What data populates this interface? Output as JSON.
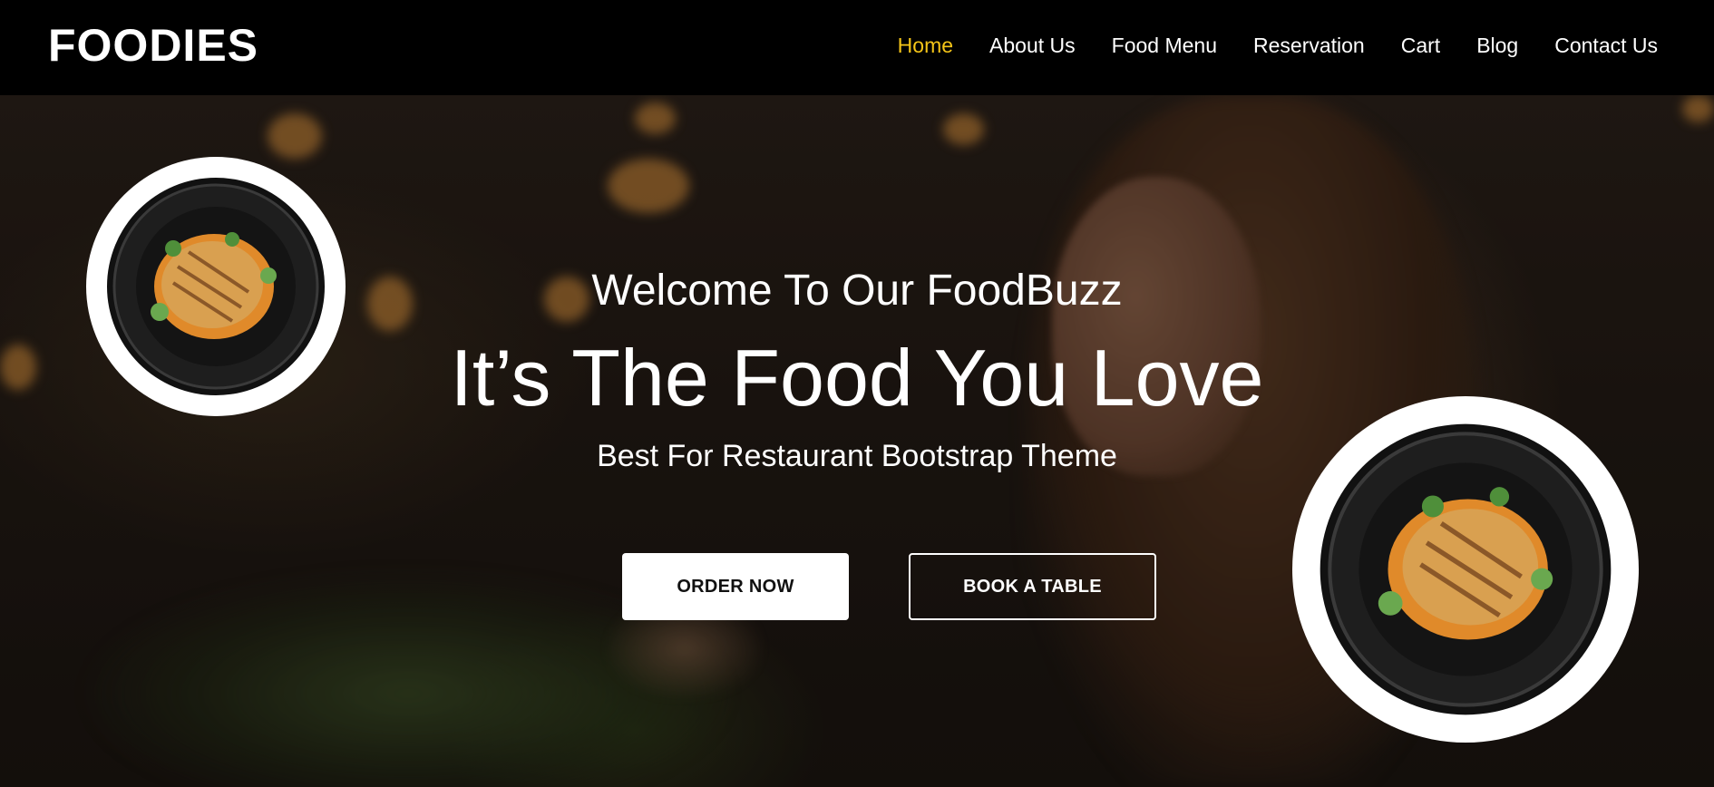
{
  "brand": "FOODIES",
  "nav": {
    "items": [
      {
        "label": "Home",
        "active": true
      },
      {
        "label": "About Us",
        "active": false
      },
      {
        "label": "Food Menu",
        "active": false
      },
      {
        "label": "Reservation",
        "active": false
      },
      {
        "label": "Cart",
        "active": false
      },
      {
        "label": "Blog",
        "active": false
      },
      {
        "label": "Contact Us",
        "active": false
      }
    ]
  },
  "hero": {
    "welcome": "Welcome To Our FoodBuzz",
    "headline": "It’s The Food You Love",
    "subline": "Best For Restaurant Bootstrap Theme",
    "order_button": "ORDER NOW",
    "book_button": "BOOK A TABLE"
  },
  "colors": {
    "accent": "#f5c518",
    "navbar_bg": "#000000",
    "text": "#ffffff"
  },
  "icons": {
    "plate_left": "food-plate-image",
    "plate_right": "food-plate-image"
  }
}
